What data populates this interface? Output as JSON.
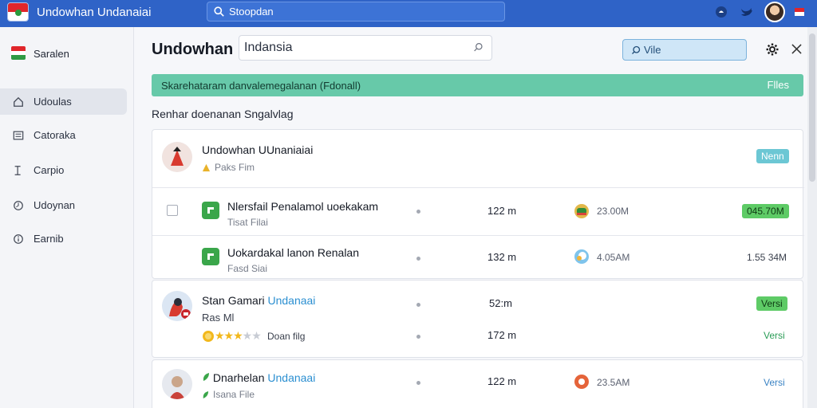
{
  "topbar": {
    "app_title": "Undowhan Undanaiai",
    "search_value": "Stoopdan"
  },
  "sidebar": {
    "header": "Saralen",
    "items": [
      {
        "label": "Udoulas",
        "icon": "home-icon",
        "active": true
      },
      {
        "label": "Catoraka",
        "icon": "list-icon",
        "active": false
      },
      {
        "label": "Carpio",
        "icon": "document-icon",
        "active": false
      },
      {
        "label": "Udoynan",
        "icon": "clock-icon",
        "active": false
      },
      {
        "label": "Earnib",
        "icon": "info-icon",
        "active": false
      }
    ]
  },
  "main": {
    "page_title": "Undowhan",
    "title_input_value": "Indansia",
    "view_button": "Vile",
    "banner": {
      "text": "Skarehataram danvalemegalanan (Fdonall)",
      "action": "Flles"
    },
    "section_title": "Renhar doenanan Sngalvlag",
    "card1": {
      "header": {
        "name": "Undowhan UUnaniaiai",
        "sub": "Paks Fim",
        "badge": "Nenn"
      },
      "rows": [
        {
          "name": "Nlersfail Penalamol uoekakam",
          "sub": "Tisat Filai",
          "size": "122 m",
          "value": "23.00M",
          "right": "045.70M"
        },
        {
          "name": "Uokardakal lanon Renalan",
          "sub": "Fasd Siai",
          "size": "132 m",
          "value": "4.05AM",
          "right": "1.55 34M"
        }
      ]
    },
    "card2": {
      "name_prefix": "Stan Gamari",
      "name_highlight": "Undanaai",
      "sub": "Ras Ml",
      "rating_label": "Doan filg",
      "rating": 3,
      "size1": "52:m",
      "size2": "172 m",
      "badge1": "Versi",
      "badge2": "Versi"
    },
    "card3": {
      "name_prefix": "Dnarhelan",
      "name_highlight": "Undanaai",
      "sub": "Isana File",
      "size": "122 m",
      "value": "23.5AM",
      "badge": "Versi"
    }
  },
  "colors": {
    "topbar": "#2f63c7",
    "banner": "#67c9a9",
    "accent_green": "#3aa64a",
    "accent_blue": "#2b8fd1"
  }
}
